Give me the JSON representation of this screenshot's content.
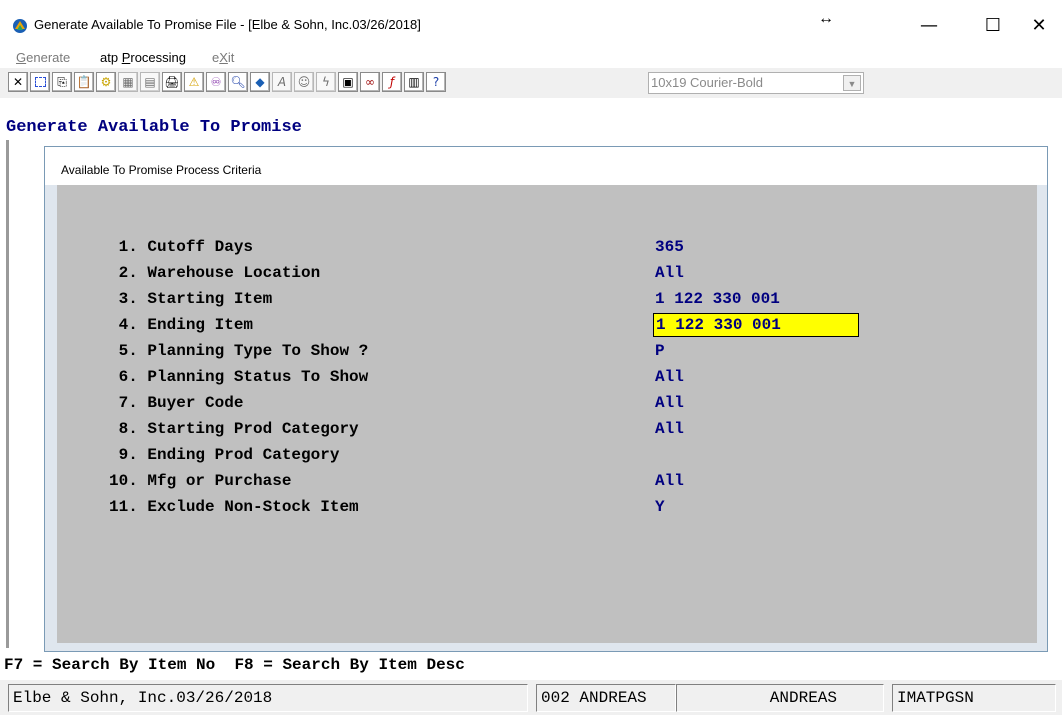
{
  "window": {
    "title": "Generate Available To Promise File - [Elbe & Sohn, Inc.03/26/2018]",
    "resize_glyph": "↔",
    "minimize": "—",
    "maximize": "☐",
    "close": "✕"
  },
  "menu": [
    {
      "label": "Generate",
      "access": "G",
      "enabled": false
    },
    {
      "label": "atp Processing",
      "access": "P",
      "enabled": true
    },
    {
      "label": "eXit",
      "access": "X",
      "enabled": false
    }
  ],
  "toolbar": {
    "icons": [
      "close-icon",
      "select-icon",
      "copy-icon",
      "paste-icon",
      "settings-icon",
      "properties-icon",
      "document-icon",
      "print-icon",
      "warning-icon",
      "binoculars-icon",
      "search-icon",
      "app-logo-icon",
      "font-icon",
      "user-icon",
      "lightning-icon",
      "calculator-icon",
      "link-icon",
      "function-icon",
      "list-icon",
      "help-icon"
    ],
    "font_selector": "10x19 Courier-Bold"
  },
  "screen": {
    "heading": "Generate Available To Promise"
  },
  "panel": {
    "title": "Available To Promise Process Criteria",
    "criteria": [
      {
        "label": " 1. Cutoff Days",
        "value": "365"
      },
      {
        "label": " 2. Warehouse Location",
        "value": "All"
      },
      {
        "label": " 3. Starting Item",
        "value": "1 122 330 001"
      },
      {
        "label": " 4. Ending Item",
        "value": "1 122 330 001",
        "active": true
      },
      {
        "label": " 5. Planning Type To Show ?",
        "value": "P"
      },
      {
        "label": " 6. Planning Status To Show",
        "value": "All"
      },
      {
        "label": " 7. Buyer Code",
        "value": "All"
      },
      {
        "label": " 8. Starting Prod Category",
        "value": "All"
      },
      {
        "label": " 9. Ending Prod Category",
        "value": ""
      },
      {
        "label": "10. Mfg or Purchase",
        "value": "All"
      },
      {
        "label": "11. Exclude Non-Stock Item",
        "value": "Y"
      }
    ]
  },
  "function_keys": "F7 = Search By Item No  F8 = Search By Item Desc",
  "status": {
    "company": "Elbe & Sohn, Inc.03/26/2018",
    "user": "002 ANDREAS",
    "operator": "ANDREAS",
    "program": "IMATPGSN"
  },
  "colors": {
    "heading": "#000080",
    "value": "#000080",
    "active_field": "#ffff00",
    "panel_body": "#c0c0c0"
  }
}
